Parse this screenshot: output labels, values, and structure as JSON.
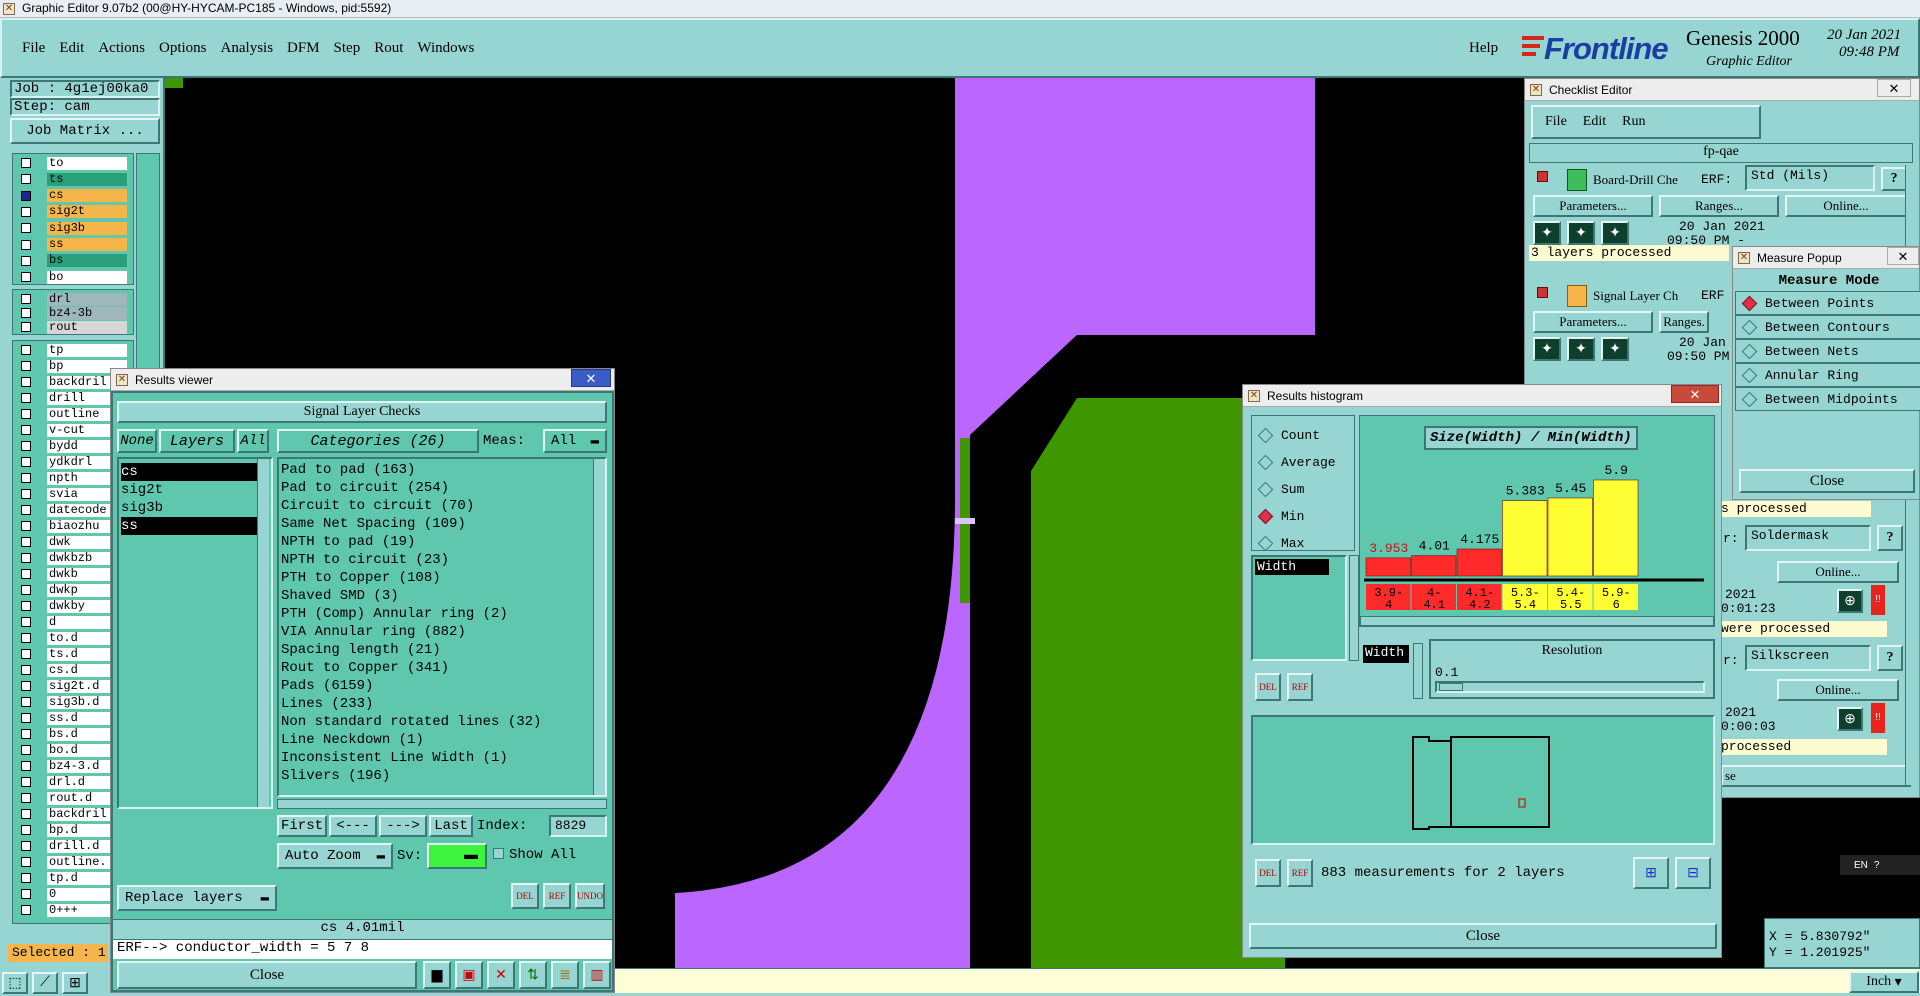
{
  "window_title": "Graphic Editor 9.07b2 (00@HY-HYCAM-PC185 - Windows, pid:5592)",
  "menu": [
    "File",
    "Edit",
    "Actions",
    "Options",
    "Analysis",
    "DFM",
    "Step",
    "Rout",
    "Windows"
  ],
  "help_label": "Help",
  "brand": {
    "logo": "Frontline",
    "product": "Genesis 2000",
    "sub": "Graphic Editor",
    "date": "20 Jan 2021",
    "time": "09:48 PM"
  },
  "job": {
    "job_label": "Job : 4g1ej00ka0",
    "step_label": "Step: cam",
    "matrix_button": "Job Matrix ..."
  },
  "layers": [
    {
      "name": "to",
      "color": "#ffffff"
    },
    {
      "name": "ts",
      "color": "#2aa07a"
    },
    {
      "name": "cs",
      "color": "#f5b54a"
    },
    {
      "name": "sig2t",
      "color": "#f5b54a"
    },
    {
      "name": "sig3b",
      "color": "#f5b54a"
    },
    {
      "name": "ss",
      "color": "#f5b54a"
    },
    {
      "name": "bs",
      "color": "#2aa07a"
    },
    {
      "name": "bo",
      "color": "#ffffff"
    }
  ],
  "layers2": [
    {
      "name": "drl",
      "color": "#9fb6bb"
    },
    {
      "name": "bz4-3b",
      "color": "#9fb6bb"
    },
    {
      "name": "rout",
      "color": "#d6d6d6"
    }
  ],
  "layers3": [
    "tp",
    "bp",
    "backdril",
    "drill",
    "outline",
    "v-cut",
    "bydd",
    "ydkdrl",
    "npth",
    "svia",
    "datecode",
    "biaozhu",
    "dwk",
    "dwkbzb",
    "dwkb",
    "dwkp",
    "dwkby",
    "d",
    "to.d",
    "ts.d",
    "cs.d",
    "sig2t.d",
    "sig3b.d",
    "ss.d",
    "bs.d",
    "bo.d",
    "bz4-3.d",
    "drl.d",
    "rout.d",
    "backdril",
    "bp.d",
    "drill.d",
    "outline.",
    "tp.d",
    "0",
    "0+++"
  ],
  "selected_label": "Selected : 1",
  "results_viewer": {
    "title": "Results viewer",
    "header": "Signal Layer Checks",
    "none": "None",
    "layers": "Layers",
    "all": "All",
    "categories_label": "Categories (26)",
    "meas_label": "Meas:",
    "meas_value": "All",
    "layer_list": [
      "cs",
      "sig2t",
      "sig3b",
      "ss"
    ],
    "categories": [
      "Pad to pad (163)",
      "Pad to circuit (254)",
      "Circuit to circuit (70)",
      "Same Net Spacing (109)",
      "NPTH to pad (19)",
      "NPTH to circuit (23)",
      "PTH to Copper (108)",
      "Shaved SMD (3)",
      "PTH (Comp) Annular ring (2)",
      "VIA Annular ring (882)",
      "Spacing length (21)",
      "Rout to Copper (341)",
      "Pads (6159)",
      "Lines (233)",
      "Non standard rotated lines (32)",
      "Line Neckdown (1)",
      "Inconsistent Line Width (1)",
      "Slivers (196)"
    ],
    "first": "First",
    "prev": "<---",
    "next": "--->",
    "last": "Last",
    "index_label": "Index:",
    "index_value": "8829",
    "auto_zoom": "Auto Zoom",
    "sv": "Sv:",
    "show_all": "Show All",
    "replace_layers": "Replace layers",
    "status": "cs 4.01mil",
    "erf": "ERF--> conductor_width = 5 7 8",
    "close": "Close"
  },
  "checklist": {
    "title": "Checklist Editor",
    "menu": [
      "File",
      "Edit",
      "Run"
    ],
    "name": "fp-qae",
    "rows": [
      {
        "label": "Board-Drill Che",
        "erf": "ERF:",
        "erf_value": "Std (Mils)",
        "date": "20 Jan 2021",
        "time": "09:50 PM -",
        "status": "3 layers processed"
      },
      {
        "label": "Signal Layer Ch",
        "erf": "ERF",
        "date": "20 Jan",
        "time": "09:50 PM -"
      }
    ],
    "parameters": "Parameters...",
    "ranges": "Ranges...",
    "ranges2": "Ranges.",
    "online": "Online...",
    "right_rows": [
      {
        "status": "s processed"
      },
      {
        "erf": "r:",
        "value": "Soldermask",
        "online": "Online...",
        "date": "2021",
        "time": "0:01:23",
        "status": "were processed"
      },
      {
        "erf": "r:",
        "value": "Silkscreen",
        "online": "Online...",
        "date": "2021",
        "time": "0:00:03",
        "status": "processed"
      }
    ],
    "close_partial": "se"
  },
  "measure": {
    "title": "Measure Popup",
    "mode_label": "Measure Mode",
    "modes": [
      {
        "label": "Between Points",
        "on": true
      },
      {
        "label": "Between Contours",
        "on": false
      },
      {
        "label": "Between Nets",
        "on": false
      },
      {
        "label": "Annular Ring",
        "on": false
      },
      {
        "label": "Between Midpoints",
        "on": false
      }
    ],
    "close": "Close"
  },
  "histogram": {
    "title": "Results histogram",
    "options": [
      {
        "label": "Count",
        "on": false
      },
      {
        "label": "Average",
        "on": false
      },
      {
        "label": "Sum",
        "on": false
      },
      {
        "label": "Min",
        "on": true
      },
      {
        "label": "Max",
        "on": false
      }
    ],
    "chart_title": "Size(Width) / Min(Width)",
    "list_item": "Width",
    "width_label": "Width",
    "resolution_label": "Resolution",
    "resolution_value": "0.1",
    "summary": "883 measurements for 2 layers",
    "close": "Close",
    "del": "DEL",
    "ref": "REF"
  },
  "chart_data": {
    "type": "bar",
    "title": "Size(Width) / Min(Width)",
    "categories": [
      "3.9-4",
      "4-4.1",
      "4.1-4.2",
      "5.3-5.4",
      "5.4-5.5",
      "5.9-6"
    ],
    "values": [
      3.953,
      4.01,
      4.175,
      5.383,
      5.45,
      5.9
    ],
    "value_labels": [
      "3.953",
      "4.01",
      "4.175",
      "5.383",
      "5.45",
      "5.9"
    ],
    "bar_colors": [
      "#ff2a2a",
      "#ff2a2a",
      "#ff2a2a",
      "#ffff33",
      "#ffff33",
      "#ffff33"
    ],
    "ylim": [
      3.5,
      6
    ]
  },
  "coords": {
    "x": "X = 5.830792\"",
    "y": "Y = 1.201925\"",
    "unit": "Inch"
  },
  "lang": "EN",
  "colors": {
    "canvas": "#000000",
    "copper_purple": "#bb66ff",
    "mask_green": "#3e9700",
    "panel": "#97d5d2",
    "teal": "#5ec7ae"
  }
}
